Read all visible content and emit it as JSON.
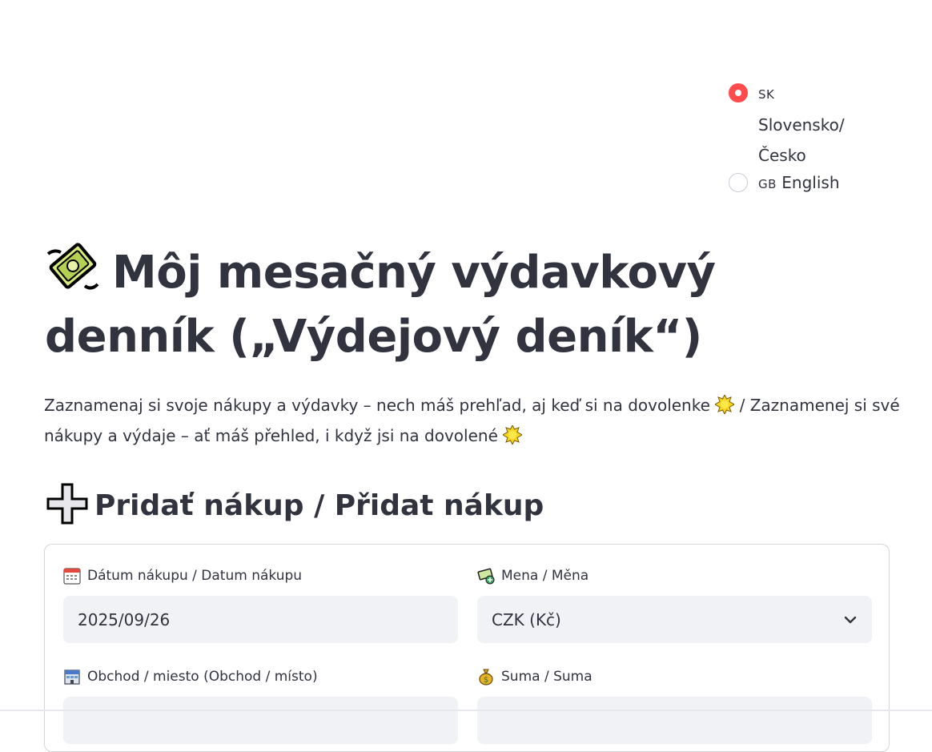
{
  "language": {
    "options": [
      {
        "code": "SK",
        "label": "Slovensko/ Česko",
        "selected": true
      },
      {
        "code": "GB",
        "label": "English",
        "selected": false
      }
    ]
  },
  "header": {
    "title": "Môj mesačný výdavkový denník („Výdejový deník“)",
    "icon": "money-with-wings-icon"
  },
  "intro": {
    "text_part1": "Zaznamenaj si svoje nákupy a výdavky – nech máš prehľad, aj keď si na dovolenke",
    "text_part2": "/ Zaznamenej si své nákupy a výdaje – ať máš přehled, i když jsi na dovolené",
    "icon": "sun-icon"
  },
  "section": {
    "title": "Pridať nákup / Přidat nákup",
    "icon": "plus-icon"
  },
  "form": {
    "date": {
      "label": "Dátum nákupu / Datum nákupu",
      "value": "2025/09/26",
      "icon": "calendar-icon"
    },
    "currency": {
      "label": "Mena / Měna",
      "value": "CZK (Kč)",
      "icon": "currency-exchange-icon"
    },
    "shop": {
      "label": "Obchod / miesto (Obchod / místo)",
      "value": "",
      "icon": "store-icon"
    },
    "amount": {
      "label": "Suma / Suma",
      "value": "",
      "icon": "money-bag-icon"
    }
  },
  "colors": {
    "accent": "#ff4b4b",
    "text": "#31333f",
    "input_bg": "#f0f2f6",
    "border": "#d6d6d9"
  }
}
